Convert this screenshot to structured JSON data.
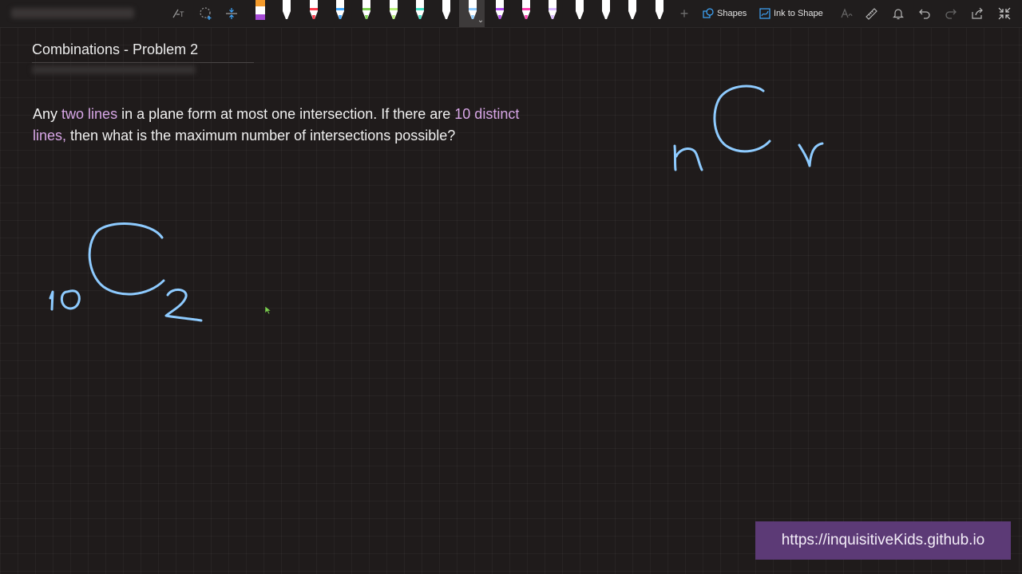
{
  "toolbar": {
    "shapes_label": "Shapes",
    "ink_to_shape_label": "Ink to Shape",
    "pens": [
      {
        "name": "orange-highlighter-pen",
        "color": "#f39a2b",
        "body": "#a64bd6"
      },
      {
        "name": "white-pen",
        "color": "#ffffff",
        "body": "#ffffff"
      },
      {
        "name": "red-pen",
        "color": "#ff3a4c",
        "body": "#ffffff"
      },
      {
        "name": "blue-pen",
        "color": "#3fa8ff",
        "body": "#ffffff"
      },
      {
        "name": "green-pen",
        "color": "#7bd14f",
        "body": "#ffffff"
      },
      {
        "name": "lime-highlighter",
        "color": "#b9f27a",
        "body": "#ffffff"
      },
      {
        "name": "teal-pen",
        "color": "#3fe0c6",
        "body": "#ffffff"
      },
      {
        "name": "white-highlighter",
        "color": "#ffffff",
        "body": "#ffffff"
      },
      {
        "name": "lightblue-pen",
        "color": "#8ecbff",
        "body": "#ffffff"
      },
      {
        "name": "purple-pen",
        "color": "#b04bf2",
        "body": "#ffffff"
      },
      {
        "name": "magenta-pen",
        "color": "#ff3fb0",
        "body": "#ffffff"
      },
      {
        "name": "lavender-highlighter",
        "color": "#d9b8ff",
        "body": "#ffffff"
      },
      {
        "name": "gray-highlighter",
        "color": "#ffffff",
        "body": "#ffffff"
      },
      {
        "name": "white-pencil",
        "color": "#ffffff",
        "body": "#ffffff"
      },
      {
        "name": "white-pen-2",
        "color": "#ffffff",
        "body": "#ffffff"
      },
      {
        "name": "white-pen-3",
        "color": "#ffffff",
        "body": "#ffffff"
      }
    ]
  },
  "page": {
    "title": "Combinations - Problem 2"
  },
  "problem": {
    "part1": "Any ",
    "highlight1": "two lines",
    "part2": " in a plane form at most one intersection. If there are ",
    "highlight2": "10 distinct lines,",
    "part3": " then what is the maximum number of intersections possible?"
  },
  "watermark": {
    "url": "https://inquisitiveKids.github.io"
  },
  "colors": {
    "background": "#1f1b1b",
    "ink": "#8ecbff",
    "highlight_text": "#d7a6e6",
    "watermark_bg": "#5c3a76"
  }
}
